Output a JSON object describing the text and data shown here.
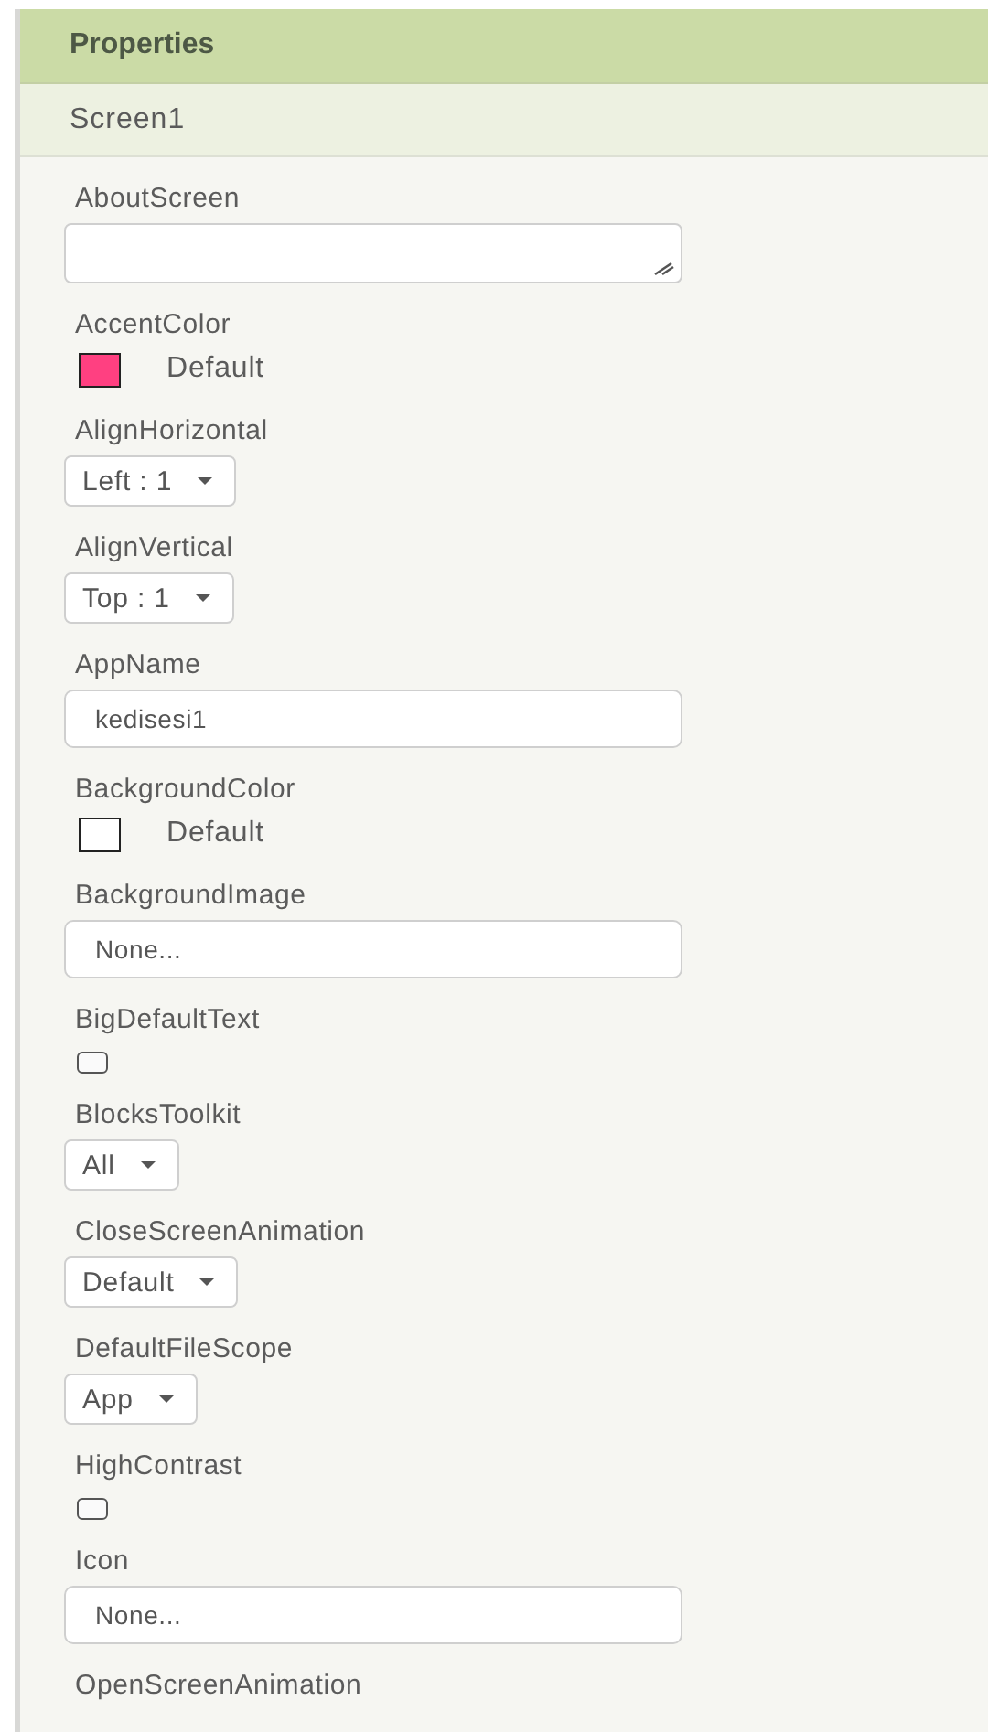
{
  "panel": {
    "title": "Properties",
    "component": "Screen1"
  },
  "properties": [
    {
      "label": "AboutScreen",
      "kind": "textarea"
    },
    {
      "label": "AccentColor",
      "kind": "color",
      "color": "#ff4081",
      "value": "Default"
    },
    {
      "label": "AlignHorizontal",
      "kind": "dropdown",
      "value": "Left : 1"
    },
    {
      "label": "AlignVertical",
      "kind": "dropdown",
      "value": "Top : 1"
    },
    {
      "label": "AppName",
      "kind": "text",
      "value": "kedisesi1"
    },
    {
      "label": "BackgroundColor",
      "kind": "color",
      "color": "#ffffff",
      "value": "Default"
    },
    {
      "label": "BackgroundImage",
      "kind": "asset",
      "value": "None..."
    },
    {
      "label": "BigDefaultText",
      "kind": "checkbox",
      "checked": false
    },
    {
      "label": "BlocksToolkit",
      "kind": "dropdown",
      "value": "All"
    },
    {
      "label": "CloseScreenAnimation",
      "kind": "dropdown",
      "value": "Default"
    },
    {
      "label": "DefaultFileScope",
      "kind": "dropdown",
      "value": "App"
    },
    {
      "label": "HighContrast",
      "kind": "checkbox",
      "checked": false
    },
    {
      "label": "Icon",
      "kind": "asset",
      "value": "None..."
    },
    {
      "label": "OpenScreenAnimation",
      "kind": "label-only"
    }
  ]
}
